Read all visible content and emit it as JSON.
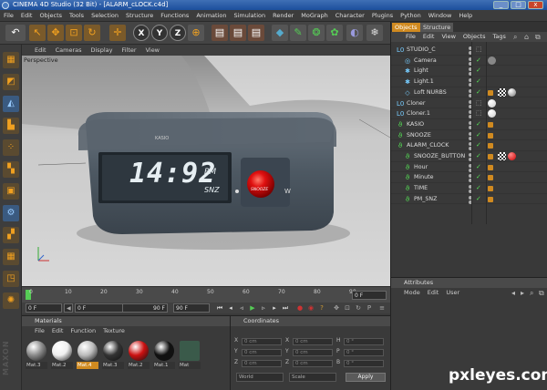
{
  "titlebar": {
    "title": "CINEMA 4D Studio (32 Bit) - [ALARM_cLOCK.c4d]",
    "min": "_",
    "max": "□",
    "close": "x"
  },
  "menubar": [
    "File",
    "Edit",
    "Objects",
    "Tools",
    "Selection",
    "Structure",
    "Functions",
    "Animation",
    "Simulation",
    "Render",
    "MoGraph",
    "Character",
    "Plugins",
    "Python",
    "Window",
    "Help"
  ],
  "viewport": {
    "menu": [
      "Edit",
      "Cameras",
      "Display",
      "Filter",
      "View"
    ],
    "label": "Perspective",
    "clock": {
      "time": "14:92",
      "pm": "PM",
      "snz": "SNZ",
      "brand": "KASIO",
      "button": "SNOOZE"
    }
  },
  "timeline": {
    "ticks": [
      "0",
      "10",
      "20",
      "30",
      "40",
      "50",
      "60",
      "70",
      "80",
      "90"
    ],
    "frame": "0 F"
  },
  "playbar": {
    "start": "0 F",
    "mid_a": "0 F",
    "mid_b": "90 F",
    "end": "90 F"
  },
  "materials": {
    "title": "Materials",
    "menu": [
      "File",
      "Edit",
      "Function",
      "Texture"
    ],
    "items": [
      {
        "label": "Mat.3",
        "color": "#8a8a8a",
        "selected": false
      },
      {
        "label": "Mat.2",
        "color": "#f0f0f0",
        "selected": false
      },
      {
        "label": "Mat.4",
        "color": "#bbbbbb",
        "selected": true
      },
      {
        "label": "Mat.3",
        "color": "#333333",
        "selected": false
      },
      {
        "label": "Mat.2",
        "color": "#cc1111",
        "selected": false
      },
      {
        "label": "Mat.1",
        "color": "#111111",
        "selected": false
      },
      {
        "label": "Mat",
        "color": "#3a5a4a",
        "selected": false
      }
    ]
  },
  "coordinates": {
    "title": "Coordinates",
    "rows": [
      {
        "a": "X",
        "av": "0 cm",
        "b": "X",
        "bv": "0 cm",
        "c": "H",
        "cv": "0 °"
      },
      {
        "a": "Y",
        "av": "0 cm",
        "b": "Y",
        "bv": "0 cm",
        "c": "P",
        "cv": "0 °"
      },
      {
        "a": "Z",
        "av": "0 cm",
        "b": "Z",
        "bv": "0 cm",
        "c": "B",
        "cv": "0 °"
      }
    ],
    "world": "World",
    "scale": "Scale",
    "apply": "Apply"
  },
  "objects": {
    "tabs": [
      "Objects",
      "Structure"
    ],
    "menu": [
      "File",
      "Edit",
      "View",
      "Objects",
      "Tags"
    ],
    "rows": [
      {
        "name": "STUDIO_C",
        "indent": 0,
        "icon": "L0",
        "tags": []
      },
      {
        "name": "Camera",
        "indent": 1,
        "icon": "◎",
        "tags": [
          "target"
        ]
      },
      {
        "name": "Light",
        "indent": 1,
        "icon": "✱",
        "tags": []
      },
      {
        "name": "Light.1",
        "indent": 1,
        "icon": "✱",
        "tags": []
      },
      {
        "name": "Loft NURBS",
        "indent": 1,
        "icon": "◇",
        "tags": [
          "phong",
          "checker",
          "sphere"
        ]
      },
      {
        "name": "Cloner",
        "indent": 0,
        "icon": "L0",
        "tags": [
          "white"
        ]
      },
      {
        "name": "Cloner.1",
        "indent": 0,
        "icon": "L0",
        "tags": [
          "white"
        ]
      },
      {
        "name": "KASIO",
        "indent": 0,
        "icon": "ϑ",
        "tags": [
          "phong"
        ]
      },
      {
        "name": "SNOOZE",
        "indent": 0,
        "icon": "ϑ",
        "tags": [
          "phong"
        ]
      },
      {
        "name": "ALARM_CLOCK",
        "indent": 0,
        "icon": "ϑ",
        "tags": [
          "phong"
        ]
      },
      {
        "name": "SNOOZE_BUTTON",
        "indent": 1,
        "icon": "ϑ",
        "tags": [
          "phong",
          "checker",
          "red"
        ]
      },
      {
        "name": "Hour",
        "indent": 1,
        "icon": "ϑ",
        "tags": [
          "phong"
        ]
      },
      {
        "name": "Minute",
        "indent": 1,
        "icon": "ϑ",
        "tags": [
          "phong"
        ]
      },
      {
        "name": "TIME",
        "indent": 1,
        "icon": "ϑ",
        "tags": [
          "phong"
        ]
      },
      {
        "name": "PM_SNZ",
        "indent": 1,
        "icon": "ϑ",
        "tags": [
          "phong"
        ]
      }
    ]
  },
  "attributes": {
    "title": "Attributes",
    "menu": [
      "Mode",
      "Edit",
      "User"
    ]
  },
  "watermark": "pxleyes.com",
  "maxon": "MAXON"
}
